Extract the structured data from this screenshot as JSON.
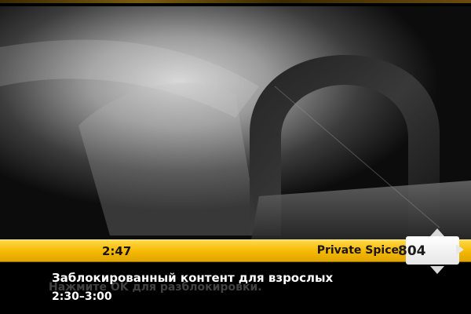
{
  "background": {
    "icon": "padlock-icon",
    "style": "grayscale locked-content backdrop"
  },
  "info_bar": {
    "time": "2:47",
    "channel_name": "Private Spice",
    "channel_number": "804",
    "accent_color": "#f4b800"
  },
  "program": {
    "title": "Заблокированный контент для взрослых",
    "time_range": "2:30–3:00",
    "hint": "Нажмите OK для разблокировки."
  }
}
